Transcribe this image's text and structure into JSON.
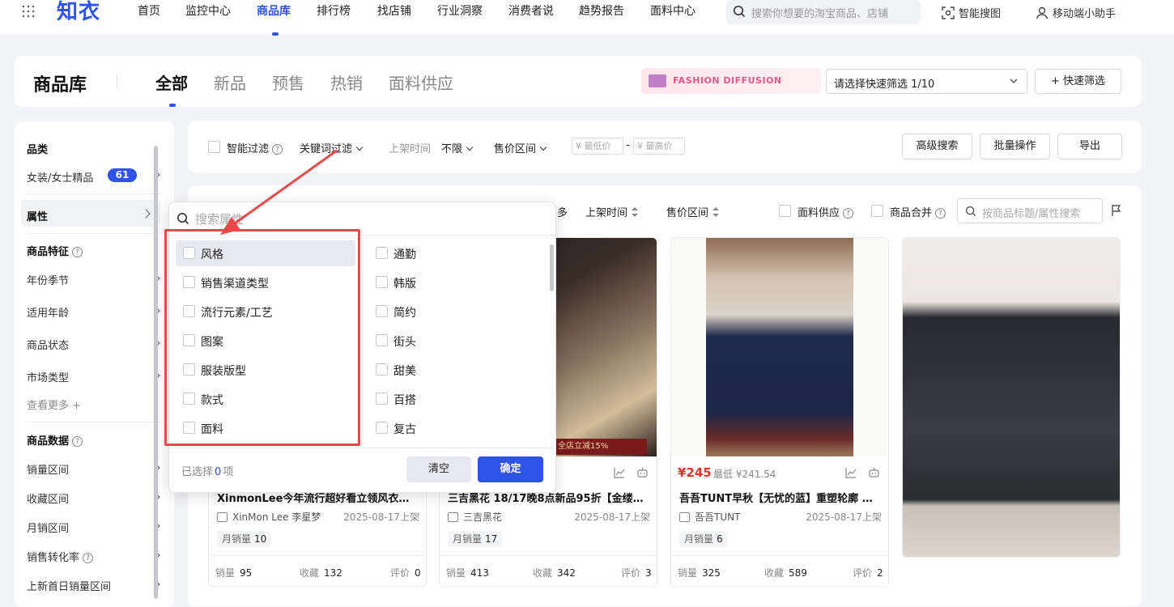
{
  "header": {
    "logo": "知衣",
    "nav": [
      "首页",
      "监控中心",
      "商品库",
      "排行榜",
      "找店铺",
      "行业洞察",
      "消费者说",
      "趋势报告",
      "面料中心"
    ],
    "search_placeholder": "搜索你想要的淘宝商品、店铺",
    "smart_search": "智能搜图",
    "mobile": "移动端小助手"
  },
  "page": {
    "title": "商品库",
    "tabs": [
      "全部",
      "新品",
      "预售",
      "热销",
      "面料供应"
    ],
    "banner_text": "FASHION DIFFUSION",
    "quick_filter_select": "请选择快速筛选 1/10",
    "quick_filter_button": "+ 快速筛选"
  },
  "sidebar": {
    "category_head": "品类",
    "category_item": "女装/女士精品",
    "category_badge": "61",
    "attribute": "属性",
    "feature_head": "商品特征",
    "feature_items": [
      "年份季节",
      "适用年龄",
      "商品状态",
      "市场类型"
    ],
    "see_more": "查看更多 +",
    "data_head": "商品数据",
    "data_items": [
      "销量区间",
      "收藏区间",
      "月销区间",
      "销售转化率",
      "上新首日销量区间"
    ]
  },
  "filters": {
    "smart_filter": "智能过滤",
    "keyword_filter": "关键词过滤",
    "listing_time_label": "上架时间",
    "listing_time_value": "不限",
    "price_range": "售价区间",
    "min_price": "¥ 最低价",
    "max_price": "¥ 最高价",
    "dash": "-",
    "advanced_search": "高级搜索",
    "batch_ops": "批量操作",
    "export": "导出"
  },
  "list_toolbar": {
    "more": "多",
    "listing_time": "上架时间",
    "price_range": "售价区间",
    "fabric_supply": "面料供应",
    "merge": "商品合并",
    "search_placeholder": "按商品标题/属性搜索"
  },
  "dropdown": {
    "search_placeholder": "搜索属性",
    "left_items": [
      "风格",
      "销售渠道类型",
      "流行元素/工艺",
      "图案",
      "服装版型",
      "款式",
      "面料"
    ],
    "right_items": [
      "通勤",
      "韩版",
      "简约",
      "街头",
      "甜美",
      "百搭",
      "复古"
    ],
    "selected_prefix": "已选择",
    "selected_count": "0",
    "selected_suffix": "项",
    "clear": "清空",
    "confirm": "确定"
  },
  "products": [
    {
      "title": "XinmonLee今年流行超好看立领风衣外...",
      "shop": "XinMon Lee 李星梦",
      "date": "2025-08-17上架",
      "monthly_label": "月销量",
      "monthly": "10",
      "sales_label": "销量",
      "sales": "95",
      "fav_label": "收藏",
      "fav": "132",
      "review_label": "评价",
      "review": "0"
    },
    {
      "title": "三吉黑花 18/17晚8点新品95折【金缕衣...",
      "shop": "三吉黑花",
      "date": "2025-08-17上架",
      "promo": "全店立减15%",
      "monthly_label": "月销量",
      "monthly": "17",
      "sales_label": "销量",
      "sales": "413",
      "fav_label": "收藏",
      "fav": "342",
      "review_label": "评价",
      "review": "3"
    },
    {
      "price": "¥245",
      "price_low": "最低 ¥241.54",
      "title": "吾吾TUNT早秋【无忧的蓝】重塑轮廓 明...",
      "shop": "吾吾TUNT",
      "date": "2025-08-17上架",
      "monthly_label": "月销量",
      "monthly": "6",
      "sales_label": "销量",
      "sales": "325",
      "fav_label": "收藏",
      "fav": "589",
      "review_label": "评价",
      "review": "2"
    }
  ],
  "colors": {
    "accent": "#2e53e6",
    "price": "#e5332b",
    "annotation": "#e84a4a"
  }
}
